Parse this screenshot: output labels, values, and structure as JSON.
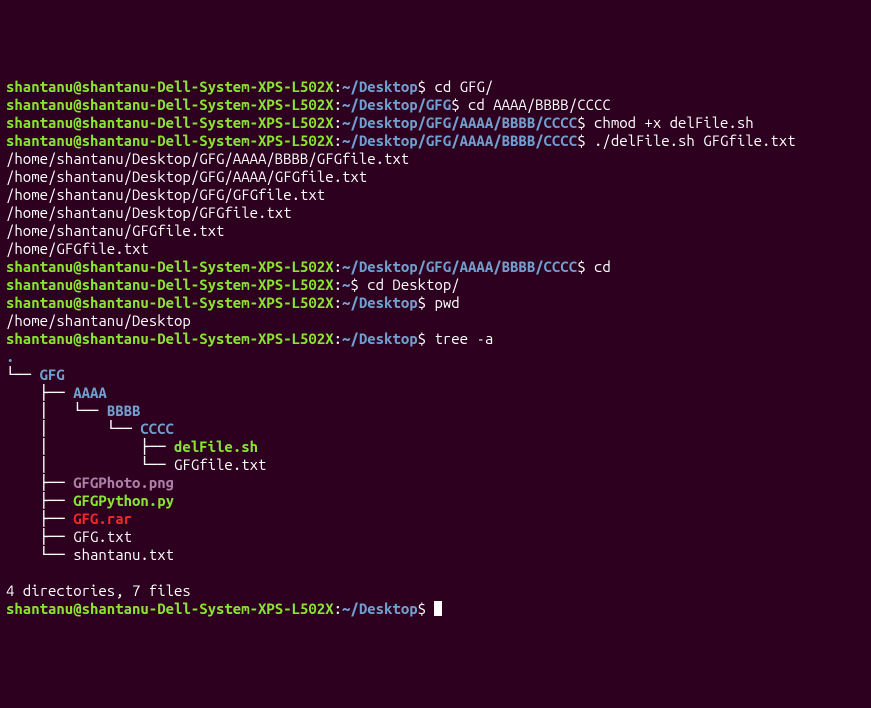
{
  "lines": [
    {
      "type": "prompt",
      "user": "shantanu@shantanu-Dell-System-XPS-L502X",
      "path": "~/Desktop",
      "cmd": "cd GFG/"
    },
    {
      "type": "prompt",
      "user": "shantanu@shantanu-Dell-System-XPS-L502X",
      "path": "~/Desktop/GFG",
      "cmd": "cd AAAA/BBBB/CCCC"
    },
    {
      "type": "prompt",
      "user": "shantanu@shantanu-Dell-System-XPS-L502X",
      "path": "~/Desktop/GFG/AAAA/BBBB/CCCC",
      "cmd": "chmod +x delFile.sh"
    },
    {
      "type": "prompt",
      "user": "shantanu@shantanu-Dell-System-XPS-L502X",
      "path": "~/Desktop/GFG/AAAA/BBBB/CCCC",
      "cmd": "./delFile.sh GFGfile.txt"
    },
    {
      "type": "out",
      "text": "/home/shantanu/Desktop/GFG/AAAA/BBBB/GFGfile.txt"
    },
    {
      "type": "out",
      "text": "/home/shantanu/Desktop/GFG/AAAA/GFGfile.txt"
    },
    {
      "type": "out",
      "text": "/home/shantanu/Desktop/GFG/GFGfile.txt"
    },
    {
      "type": "out",
      "text": "/home/shantanu/Desktop/GFGfile.txt"
    },
    {
      "type": "out",
      "text": "/home/shantanu/GFGfile.txt"
    },
    {
      "type": "out",
      "text": "/home/GFGfile.txt"
    },
    {
      "type": "prompt",
      "user": "shantanu@shantanu-Dell-System-XPS-L502X",
      "path": "~/Desktop/GFG/AAAA/BBBB/CCCC",
      "cmd": "cd"
    },
    {
      "type": "prompt",
      "user": "shantanu@shantanu-Dell-System-XPS-L502X",
      "path": "~",
      "cmd": "cd Desktop/"
    },
    {
      "type": "prompt",
      "user": "shantanu@shantanu-Dell-System-XPS-L502X",
      "path": "~/Desktop",
      "cmd": "pwd"
    },
    {
      "type": "out",
      "text": "/home/shantanu/Desktop"
    },
    {
      "type": "prompt",
      "user": "shantanu@shantanu-Dell-System-XPS-L502X",
      "path": "~/Desktop",
      "cmd": "tree -a"
    }
  ],
  "tree": {
    "root": ".",
    "rows": [
      {
        "prefix": "└── ",
        "name": "GFG",
        "cls": "dir"
      },
      {
        "prefix": "    ├── ",
        "name": "AAAA",
        "cls": "dir"
      },
      {
        "prefix": "    │   └── ",
        "name": "BBBB",
        "cls": "dir"
      },
      {
        "prefix": "    │       └── ",
        "name": "CCCC",
        "cls": "dir"
      },
      {
        "prefix": "    │           ├── ",
        "name": "delFile.sh",
        "cls": "exe"
      },
      {
        "prefix": "    │           └── ",
        "name": "GFGfile.txt",
        "cls": "out"
      },
      {
        "prefix": "    ├── ",
        "name": "GFGPhoto.png",
        "cls": "img"
      },
      {
        "prefix": "    ├── ",
        "name": "GFGPython.py",
        "cls": "exe"
      },
      {
        "prefix": "    ├── ",
        "name": "GFG.rar",
        "cls": "arc"
      },
      {
        "prefix": "    ├── ",
        "name": "GFG.txt",
        "cls": "out"
      },
      {
        "prefix": "    └── ",
        "name": "shantanu.txt",
        "cls": "out"
      }
    ],
    "summary": "4 directories, 7 files"
  },
  "final_prompt": {
    "user": "shantanu@shantanu-Dell-System-XPS-L502X",
    "path": "~/Desktop"
  }
}
